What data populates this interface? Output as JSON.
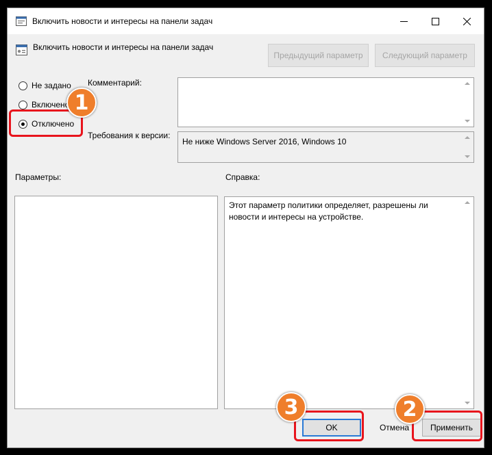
{
  "window": {
    "title": "Включить новости и интересы на панели задач"
  },
  "header": {
    "setting_name": "Включить новости и интересы на панели задач",
    "prev_button": "Предыдущий параметр",
    "next_button": "Следующий параметр"
  },
  "state": {
    "options": [
      {
        "label": "Не задано",
        "checked": false
      },
      {
        "label": "Включено",
        "checked": false
      },
      {
        "label": "Отключено",
        "checked": true
      }
    ]
  },
  "comment": {
    "label": "Комментарий:",
    "value": ""
  },
  "supported": {
    "label": "Требования к версии:",
    "value": "Не ниже Windows Server 2016, Windows 10"
  },
  "options_panel": {
    "label": "Параметры:"
  },
  "help_panel": {
    "label": "Справка:",
    "text": "Этот параметр политики определяет, разрешены ли новости и интересы на устройстве."
  },
  "buttons": {
    "ok": "OK",
    "cancel": "Отмена",
    "apply": "Применить"
  },
  "annotations": {
    "step1": "1",
    "step2": "2",
    "step3": "3",
    "color_badge": "#ef7e2b",
    "color_highlight": "#e8141c"
  }
}
